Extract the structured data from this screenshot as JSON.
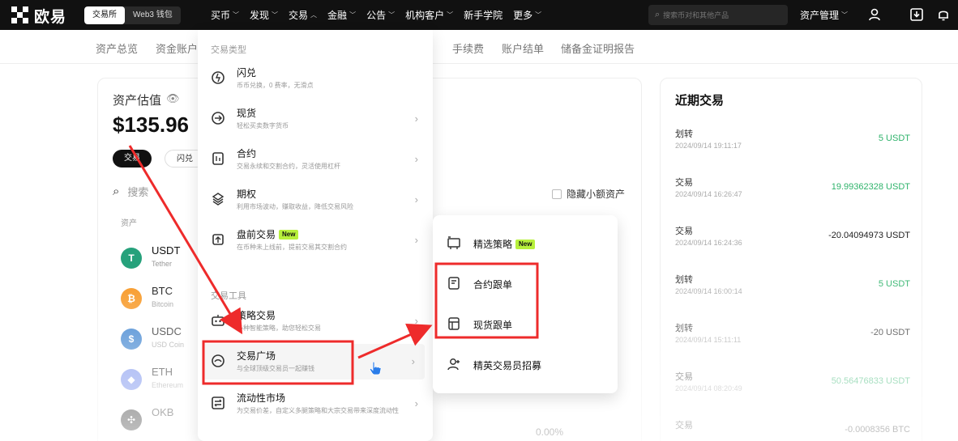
{
  "topbar": {
    "logo_text": "欧易",
    "mode_tabs": [
      "交易所",
      "Web3 钱包"
    ],
    "nav_items": [
      "买币",
      "发现",
      "交易",
      "金融",
      "公告",
      "机构客户",
      "新手学院",
      "更多"
    ],
    "search_placeholder": "搜索币对和其他产品",
    "asset_mgmt": "资产管理",
    "icons": [
      "user-icon",
      "download-icon",
      "bell-icon"
    ]
  },
  "subnav": {
    "items": [
      "资产总览",
      "资金账户",
      "手续费",
      "账户结单",
      "储备金证明报告"
    ]
  },
  "assets": {
    "title": "资产估值",
    "balance": "$135.96",
    "pills": [
      "交易",
      "闪兑"
    ],
    "search_label": "搜索",
    "column_header": "资产",
    "hide_small": "隐藏小额资产",
    "pct_value": "0.00%",
    "coins": [
      {
        "symbol": "USDT",
        "name": "Tether",
        "color": "#26a17b",
        "glyph": "T"
      },
      {
        "symbol": "BTC",
        "name": "Bitcoin",
        "color": "#f7931a",
        "glyph": "₿"
      },
      {
        "symbol": "USDC",
        "name": "USD Coin",
        "color": "#2775ca",
        "glyph": "$"
      },
      {
        "symbol": "ETH",
        "name": "Ethereum",
        "color": "#627eea",
        "glyph": "◆"
      },
      {
        "symbol": "OKB",
        "name": "",
        "color": "#111111",
        "glyph": "✣"
      }
    ]
  },
  "recent": {
    "title": "近期交易",
    "trades": [
      {
        "type": "划转",
        "date": "2024/09/14 19:11:17",
        "amount": "5 USDT",
        "positive": true
      },
      {
        "type": "交易",
        "date": "2024/09/14 16:26:47",
        "amount": "19.99362328 USDT",
        "positive": true
      },
      {
        "type": "交易",
        "date": "2024/09/14 16:24:36",
        "amount": "-20.04094973 USDT",
        "positive": false
      },
      {
        "type": "划转",
        "date": "2024/09/14 16:00:14",
        "amount": "5 USDT",
        "positive": true
      },
      {
        "type": "划转",
        "date": "2024/09/14 15:11:11",
        "amount": "-20 USDT",
        "positive": false
      },
      {
        "type": "交易",
        "date": "2024/09/14 08:20:49",
        "amount": "50.56476833 USDT",
        "positive": true
      },
      {
        "type": "交易",
        "date": "",
        "amount": "-0.0008356 BTC",
        "positive": false
      }
    ]
  },
  "dropdown": {
    "section1": "交易类型",
    "section2": "交易工具",
    "items": [
      {
        "title": "闪兑",
        "desc": "币币兑换，0 费率，无滑点",
        "badge": "",
        "chev": false
      },
      {
        "title": "现货",
        "desc": "轻松买卖数字货币",
        "badge": "",
        "chev": true
      },
      {
        "title": "合约",
        "desc": "交易永续和交割合约，灵活使用杠杆",
        "badge": "",
        "chev": true
      },
      {
        "title": "期权",
        "desc": "利用市场波动，赚取收益，降低交易风险",
        "badge": "",
        "chev": true
      },
      {
        "title": "盘前交易",
        "desc": "在币种未上线前，提前交易其交割合约",
        "badge": "New",
        "chev": true
      },
      {
        "title": "策略交易",
        "desc": "多种智能策略，助您轻松交易",
        "badge": "",
        "chev": true
      },
      {
        "title": "交易广场",
        "desc": "与全球顶级交易员一起赚钱",
        "badge": "",
        "chev": true
      },
      {
        "title": "流动性市场",
        "desc": "为交易价差，自定义多腿策略和大宗交易带来深度流动性",
        "badge": "",
        "chev": true
      }
    ]
  },
  "submenu": {
    "items": [
      {
        "label": "精选策略",
        "badge": "New"
      },
      {
        "label": "合约跟单",
        "badge": ""
      },
      {
        "label": "现货跟单",
        "badge": ""
      },
      {
        "label": "精英交易员招募",
        "badge": ""
      }
    ]
  },
  "colors": {
    "highlight_red": "#ee2b2b",
    "positive_green": "#2fb36b",
    "badge_green": "#b7f03c"
  }
}
